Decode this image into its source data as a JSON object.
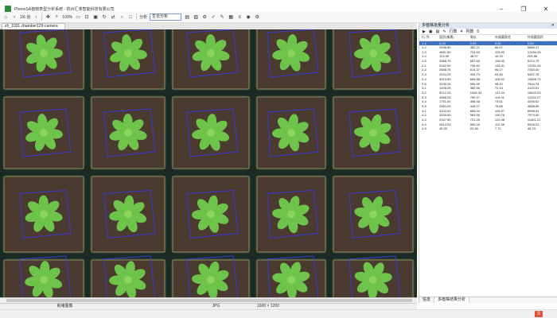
{
  "window": {
    "title": "PhenoSA植物表型分析系统 - 杭州汇萃智能科技有限公司"
  },
  "toolbar": {
    "page": "1/6 张",
    "zoom": "100%",
    "analysis_label": "分析",
    "analysis_value": "生长分析",
    "home_icon": "home-icon",
    "accent": "#7a9cc8"
  },
  "doc_tab": {
    "label": "zh_1031.chamber129-camera"
  },
  "status": {
    "left": "就绪图像",
    "format": "JPG",
    "size": "1600 × 1200"
  },
  "panel": {
    "title": "多植株批量分析",
    "tool_rows_label": "行数",
    "tool_rows_value": "4",
    "tool_cols_label": "列数",
    "tool_cols_value": "5",
    "columns": [
      "行-列",
      "面积(像素)",
      "周长",
      "外接圆直径",
      "外接圆面积"
    ],
    "rows": [
      [
        "1-1",
        "0.00",
        "0.00",
        "0.00",
        "0.00"
      ],
      [
        "1-2",
        "2938.50",
        "482.21",
        "86.57",
        "5886.47"
      ],
      [
        "1-3",
        "4651.50",
        "703.63",
        "125.93",
        "12454.25"
      ],
      [
        "1-4",
        "124.90",
        "48.97",
        "16.15",
        "205.88"
      ],
      [
        "1-5",
        "3368.75",
        "687.63",
        "108.32",
        "9214.75"
      ],
      [
        "2-1",
        "5182.00",
        "706.62",
        "128.31",
        "12931.34"
      ],
      [
        "2-2",
        "2688.75",
        "614.37",
        "96.17",
        "7263.00"
      ],
      [
        "2-3",
        "2024.25",
        "434.73",
        "83.30",
        "5457.78"
      ],
      [
        "2-4",
        "4919.50",
        "665.88",
        "116.00",
        "10609.72"
      ],
      [
        "2-5",
        "3230.25",
        "556.99",
        "98.40",
        "7604.78"
      ],
      [
        "3-1",
        "1428.25",
        "389.56",
        "72.43",
        "4120.51"
      ],
      [
        "3-2",
        "5212.25",
        "1046.34",
        "141.04",
        "15623.53"
      ],
      [
        "3-3",
        "4586.25",
        "790.47",
        "119.91",
        "11294.27"
      ],
      [
        "3-4",
        "1751.00",
        "408.48",
        "73.61",
        "4255.52"
      ],
      [
        "3-5",
        "2083.25",
        "445.07",
        "78.89",
        "4888.85"
      ],
      [
        "4-1",
        "3103.00",
        "608.04",
        "106.97",
        "8998.91"
      ],
      [
        "4-2",
        "3339.00",
        "563.55",
        "100.76",
        "7974.00"
      ],
      [
        "4-3",
        "2947.50",
        "721.25",
        "120.48",
        "11401.21"
      ],
      [
        "4-4",
        "2614.25",
        "590.04",
        "112.38",
        "9918.22"
      ],
      [
        "4-5",
        "40.00",
        "22.38",
        "7.71",
        "46.70"
      ]
    ],
    "tabs": [
      "信息",
      "多植株结果分析"
    ]
  },
  "taskbar": {
    "tray": "S"
  }
}
